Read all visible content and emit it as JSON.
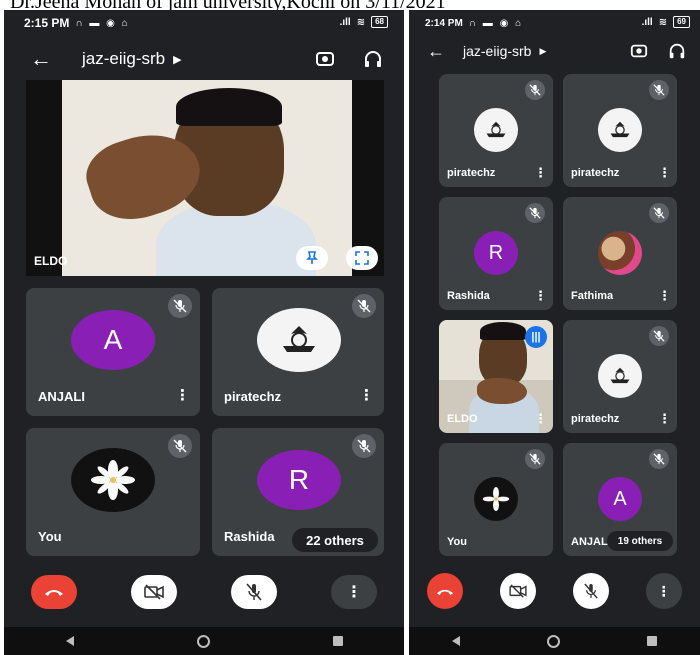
{
  "caption": "Dr.Jeena Mohan of jain university,Kochi on 3/11/2021",
  "screen_left": {
    "status": {
      "time": "2:15 PM",
      "battery": "68"
    },
    "meeting_code": "jaz-eiig-srb",
    "featured": {
      "name": "ELDO"
    },
    "tiles": [
      {
        "name": "ANJALI",
        "avatar_letter": "A"
      },
      {
        "name": "piratechz"
      },
      {
        "name": "You"
      },
      {
        "name": "Rashida",
        "avatar_letter": "R"
      }
    ],
    "others_count": "22 others"
  },
  "screen_right": {
    "status": {
      "time": "2:14 PM",
      "battery": "69"
    },
    "meeting_code": "jaz-eiig-srb",
    "tiles": [
      {
        "name": "piratechz"
      },
      {
        "name": "piratechz"
      },
      {
        "name": "Rashida",
        "avatar_letter": "R"
      },
      {
        "name": "Fathima"
      },
      {
        "name": "ELDO"
      },
      {
        "name": "piratechz"
      },
      {
        "name": "You"
      },
      {
        "name": "ANJALI",
        "avatar_letter": "A"
      }
    ],
    "others_count": "19 others"
  },
  "icons": {
    "back": "arrow-left-icon",
    "switch_camera": "switch-camera-icon",
    "audio": "headphones-icon",
    "mic_off": "mic-off-icon",
    "more": "more-vert-icon",
    "end_call": "end-call-icon",
    "camera_off": "camera-off-icon",
    "pin": "pin-icon",
    "fullscreen": "fullscreen-icon"
  },
  "colors": {
    "background": "#202124",
    "tile": "#3c4043",
    "end_call": "#ea4335",
    "avatar_purple": "#8a1fb5",
    "accent_blue": "#1a73e8"
  }
}
